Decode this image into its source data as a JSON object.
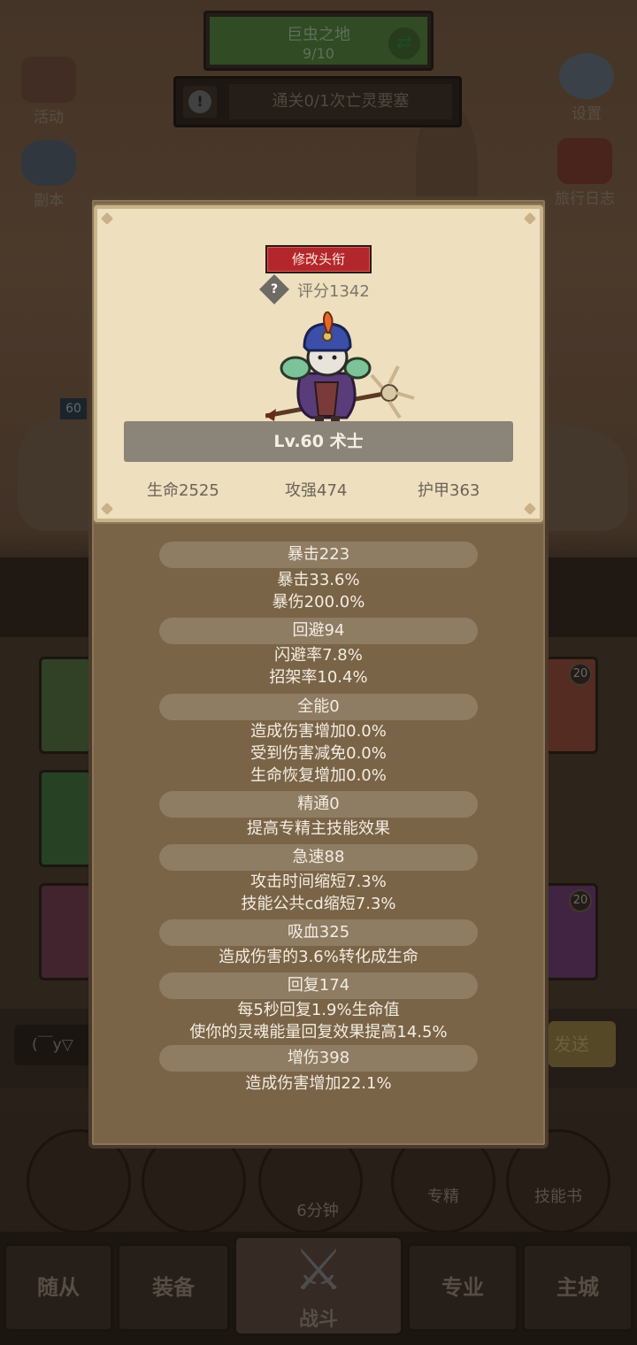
{
  "top": {
    "stage_name": "巨虫之地",
    "stage_progress": "9/10",
    "quest_text": "通关0/1次亡灵要塞",
    "alert_glyph": "!"
  },
  "side_buttons": {
    "events": "活动",
    "dungeon": "副本",
    "settings": "设置",
    "travel_log": "旅行日志"
  },
  "level_badge": "60",
  "card_badges": [
    "20",
    "20"
  ],
  "chat": {
    "input_text": "(￣y▽",
    "send_label": "发送"
  },
  "skills": {
    "timer": "6分钟",
    "mastery": "专精",
    "skill_book": "技能书"
  },
  "tabs": {
    "followers": "随从",
    "equipment": "装备",
    "battle": "战斗",
    "profession": "专业",
    "main_city": "主城"
  },
  "profile": {
    "rename_button": "修改头衔",
    "help_glyph": "?",
    "score": "评分1342",
    "level_class": "Lv.60 术士",
    "hp": "生命2525",
    "attack": "攻强474",
    "armor": "护甲363"
  },
  "attributes": [
    {
      "header": "暴击223",
      "lines": [
        "暴击33.6%",
        "暴伤200.0%"
      ]
    },
    {
      "header": "回避94",
      "lines": [
        "闪避率7.8%",
        "招架率10.4%"
      ]
    },
    {
      "header": "全能0",
      "lines": [
        "造成伤害增加0.0%",
        "受到伤害减免0.0%",
        "生命恢复增加0.0%"
      ]
    },
    {
      "header": "精通0",
      "lines": [
        "提高专精主技能效果"
      ]
    },
    {
      "header": "急速88",
      "lines": [
        "攻击时间缩短7.3%",
        "技能公共cd缩短7.3%"
      ]
    },
    {
      "header": "吸血325",
      "lines": [
        "造成伤害的3.6%转化成生命"
      ]
    },
    {
      "header": "回复174",
      "lines": [
        "每5秒回复1.9%生命值",
        "使你的灵魂能量回复效果提高14.5%"
      ]
    },
    {
      "header": "增伤398",
      "lines": [
        "造成伤害增加22.1%"
      ]
    }
  ],
  "colors": {
    "rename_red": "#b3262b",
    "card_bg": "#eedfbe",
    "panel_bg": "#7a6447"
  }
}
